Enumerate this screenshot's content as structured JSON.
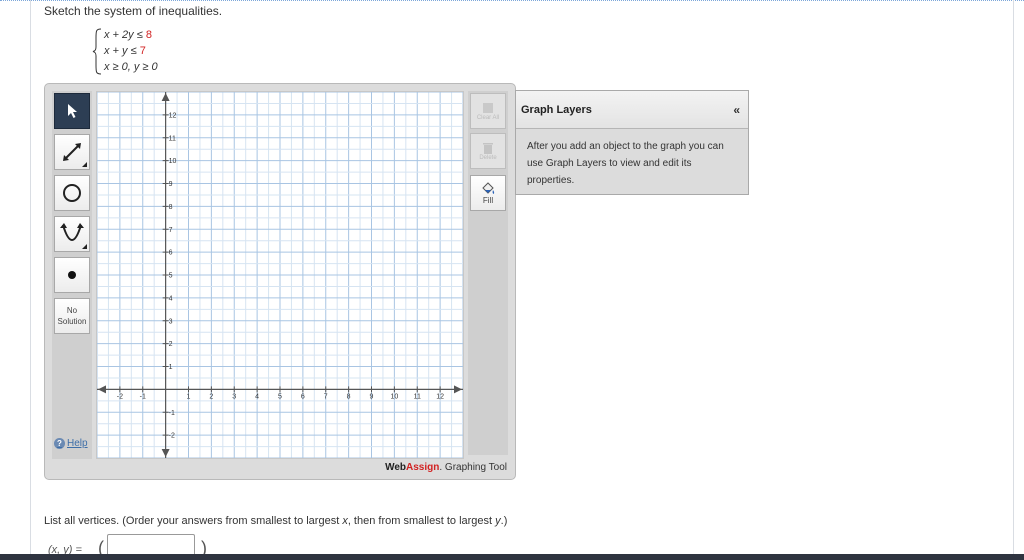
{
  "question": {
    "prompt": "Sketch the system of inequalities.",
    "inequalities": [
      {
        "lhs": "x + 2y ≤ ",
        "rhs": "8"
      },
      {
        "lhs": "x + y ≤ ",
        "rhs": "7"
      },
      {
        "lhs": "x ≥ 0, y ≥ 0",
        "rhs": ""
      }
    ],
    "accent_color": "#d22222"
  },
  "tool": {
    "left_tools": [
      {
        "name": "pointer",
        "icon": "pointer-arrow-icon",
        "active": true
      },
      {
        "name": "line",
        "icon": "line-ray-icon",
        "active": false
      },
      {
        "name": "circle",
        "icon": "circle-icon",
        "active": false
      },
      {
        "name": "parabola",
        "icon": "parabola-icon",
        "active": false
      },
      {
        "name": "point",
        "icon": "point-icon",
        "active": false
      }
    ],
    "no_solution_line1": "No",
    "no_solution_line2": "Solution",
    "help_label": "Help",
    "right_tools": {
      "clear_all": "Clear All",
      "delete": "Delete",
      "fill": "Fill"
    },
    "brand_web": "Web",
    "brand_assign": "Assign",
    "brand_suffix": ". Graphing Tool"
  },
  "layers": {
    "title": "Graph Layers",
    "collapse_glyph": "«",
    "description": "After you add an object to the graph you can use Graph Layers to view and edit its properties."
  },
  "instructions": {
    "before_x": "List all vertices. (Order your answers from smallest to largest ",
    "x": "x",
    "between": ", then from smallest to largest ",
    "y": "y",
    "after": ".)"
  },
  "answer": {
    "label": "(x, y) =",
    "open_paren": "(",
    "close_paren": ")",
    "value": ""
  },
  "chart_data": {
    "type": "grid",
    "xlim": [
      -3,
      13
    ],
    "ylim": [
      -3,
      13
    ],
    "grid": true,
    "x_ticks": [
      -2,
      -1,
      1,
      2,
      3,
      4,
      5,
      6,
      7,
      8,
      9,
      10,
      11,
      12
    ],
    "y_ticks": [
      -2,
      -1,
      1,
      2,
      3,
      4,
      5,
      6,
      7,
      8,
      9,
      10,
      11,
      12
    ]
  }
}
